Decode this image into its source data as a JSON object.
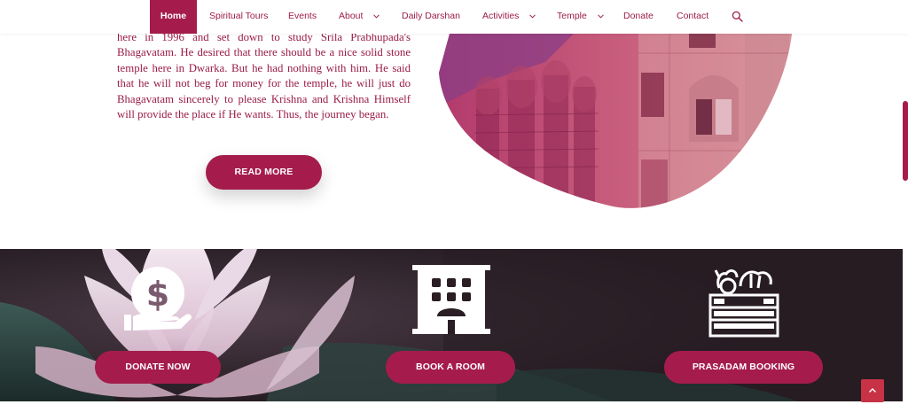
{
  "nav": {
    "items": [
      {
        "label": "Home",
        "active": true
      },
      {
        "label": "Spiritual Tours"
      },
      {
        "label": "Events"
      },
      {
        "label": "About",
        "dropdown": true
      },
      {
        "label": "Daily Darshan"
      },
      {
        "label": "Activities",
        "dropdown": true
      },
      {
        "label": "Temple",
        "dropdown": true
      },
      {
        "label": "Donate"
      },
      {
        "label": "Contact"
      }
    ],
    "search_icon": "search-icon"
  },
  "about": {
    "paragraph": "here in 1996 and set down to study Srila Prabhupada's Bhagavatam. He desired that there should be a nice solid stone temple here in Dwarka. But he had nothing with him. He said that he will not beg for money for the temple, he will just do Bhagavatam sincerely to please Krishna and Krishna Himself will provide the place if He wants. Thus, the journey began.",
    "read_more_label": "READ MORE"
  },
  "services": {
    "donate": {
      "label": "DONATE NOW",
      "icon": "donation-coin-icon"
    },
    "book_room": {
      "label": "BOOK A ROOM",
      "icon": "hotel-building-icon"
    },
    "prasadam": {
      "label": "PRASADAM BOOKING",
      "icon": "food-crate-icon"
    }
  },
  "colors": {
    "accent": "#a51c4c",
    "text": "#9a1c46",
    "scroll_top": "#c73246"
  }
}
